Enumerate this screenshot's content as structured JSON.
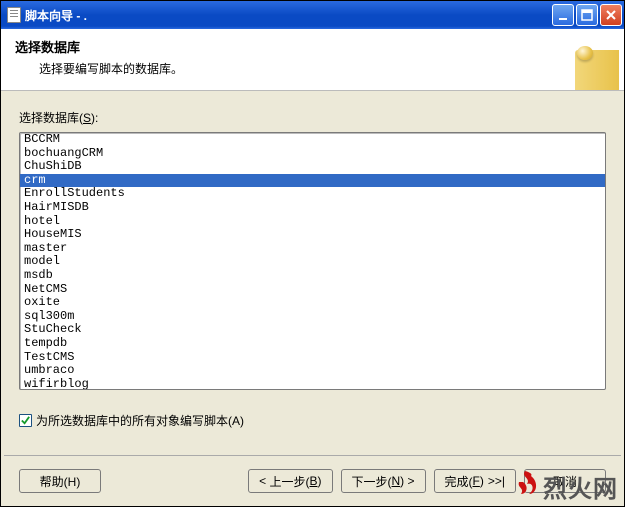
{
  "window": {
    "title": "脚本向导 - ."
  },
  "header": {
    "title": "选择数据库",
    "subtitle": "选择要编写脚本的数据库。"
  },
  "list": {
    "label_prefix": "选择数据库(",
    "label_mnemonic": "S",
    "label_suffix": "):",
    "items": [
      {
        "name": "BCCRM",
        "selected": false
      },
      {
        "name": "bochuangCRM",
        "selected": false
      },
      {
        "name": "ChuShiDB",
        "selected": false
      },
      {
        "name": "crm",
        "selected": true
      },
      {
        "name": "EnrollStudents",
        "selected": false
      },
      {
        "name": "HairMISDB",
        "selected": false
      },
      {
        "name": "hotel",
        "selected": false
      },
      {
        "name": "HouseMIS",
        "selected": false
      },
      {
        "name": "master",
        "selected": false
      },
      {
        "name": "model",
        "selected": false
      },
      {
        "name": "msdb",
        "selected": false
      },
      {
        "name": "NetCMS",
        "selected": false
      },
      {
        "name": "oxite",
        "selected": false
      },
      {
        "name": "sql300m",
        "selected": false
      },
      {
        "name": "StuCheck",
        "selected": false
      },
      {
        "name": "tempdb",
        "selected": false
      },
      {
        "name": "TestCMS",
        "selected": false
      },
      {
        "name": "umbraco",
        "selected": false
      },
      {
        "name": "wifirblog",
        "selected": false
      }
    ]
  },
  "checkbox": {
    "checked": true,
    "label_prefix": "为所选数据库中的所有对象编写脚本(",
    "label_mnemonic": "A",
    "label_suffix": ")"
  },
  "buttons": {
    "help": "帮助(H)",
    "prev_prefix": "上一步(",
    "prev_mnemonic": "B",
    "prev_suffix": ")",
    "next_prefix": "下一步(",
    "next_mnemonic": "N",
    "next_suffix": ") >",
    "finish_prefix": "完成(",
    "finish_mnemonic": "F",
    "finish_suffix": ")",
    "finish_tail": ">>|",
    "cancel": "取消"
  },
  "watermark": {
    "text": "烈火网"
  }
}
